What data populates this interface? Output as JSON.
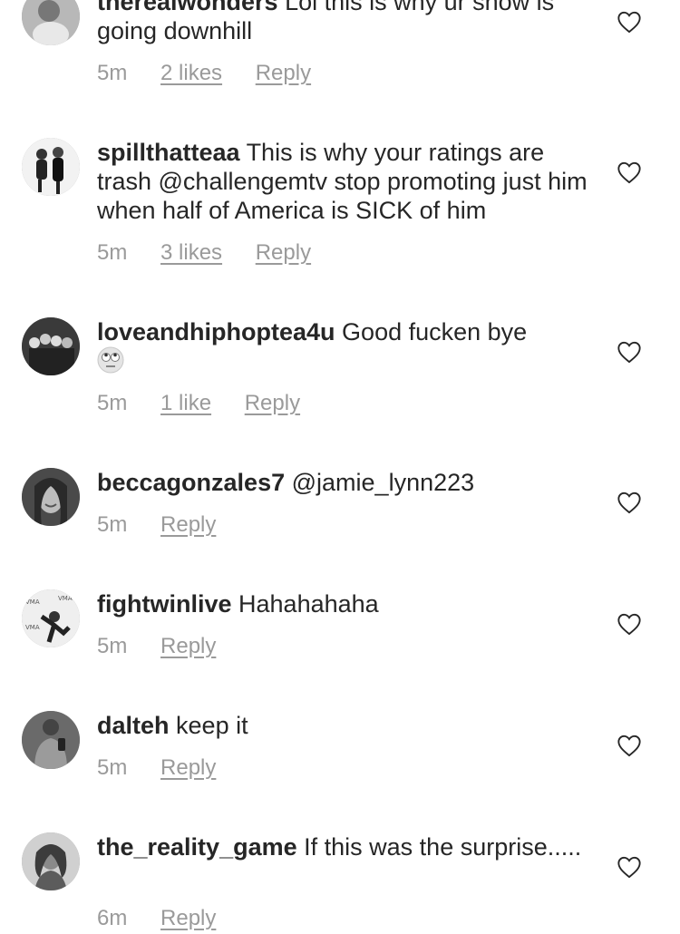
{
  "comments": [
    {
      "username": "therealwonders",
      "text": "Lol this is why ur show is going downhill",
      "time": "5m",
      "likes": "2 likes",
      "reply": "Reply"
    },
    {
      "username": "spillthatteaa",
      "text": "This is why your ratings are trash @challengemtv stop promoting just him when half of America is SICK of him",
      "time": "5m",
      "likes": "3 likes",
      "reply": "Reply"
    },
    {
      "username": "loveandhiphoptea4u",
      "text": "Good fucken bye",
      "emoji": "rolling-eyes-emoji",
      "time": "5m",
      "likes": "1 like",
      "reply": "Reply"
    },
    {
      "username": "beccagonzales7",
      "text": "@jamie_lynn223",
      "time": "5m",
      "reply": "Reply"
    },
    {
      "username": "fightwinlive",
      "text": "Hahahahaha",
      "time": "5m",
      "reply": "Reply"
    },
    {
      "username": "dalteh",
      "text": "keep it",
      "time": "5m",
      "reply": "Reply"
    },
    {
      "username": "the_reality_game",
      "text": "If this was the surprise.....",
      "time": "6m",
      "reply": "Reply"
    }
  ],
  "icons": {
    "like": "heart-outline-icon"
  },
  "colors": {
    "text": "#262626",
    "meta": "#9a9a9a",
    "background": "#ffffff"
  }
}
